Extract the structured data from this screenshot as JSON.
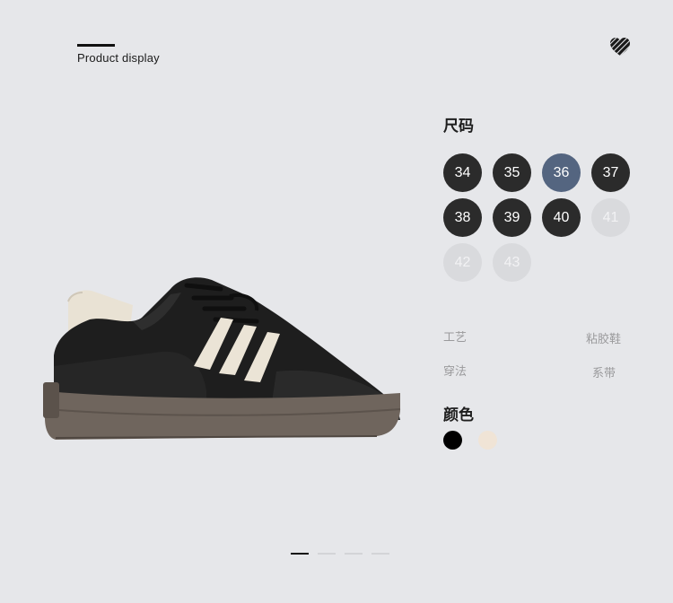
{
  "header": {
    "title": "Product display"
  },
  "sizes": {
    "label": "尺码",
    "items": [
      {
        "value": "34",
        "state": "available"
      },
      {
        "value": "35",
        "state": "available"
      },
      {
        "value": "36",
        "state": "selected"
      },
      {
        "value": "37",
        "state": "available"
      },
      {
        "value": "38",
        "state": "available"
      },
      {
        "value": "39",
        "state": "available"
      },
      {
        "value": "40",
        "state": "available"
      },
      {
        "value": "41",
        "state": "disabled"
      },
      {
        "value": "42",
        "state": "disabled"
      },
      {
        "value": "43",
        "state": "disabled"
      }
    ]
  },
  "specs": [
    {
      "key": "工艺",
      "value": "粘胶鞋"
    },
    {
      "key": "穿法",
      "value": "系带"
    }
  ],
  "colors": {
    "label": "颜色",
    "swatches": [
      {
        "name": "black",
        "hex": "#000000"
      },
      {
        "name": "cream",
        "hex": "#f0e4d6"
      }
    ]
  },
  "pager": {
    "count": 4,
    "active_index": 0
  },
  "palette": {
    "background": "#e6e7ea",
    "chip": "#2b2b2b",
    "chip_selected": "#546580",
    "chip_disabled": "#d9dadd"
  }
}
